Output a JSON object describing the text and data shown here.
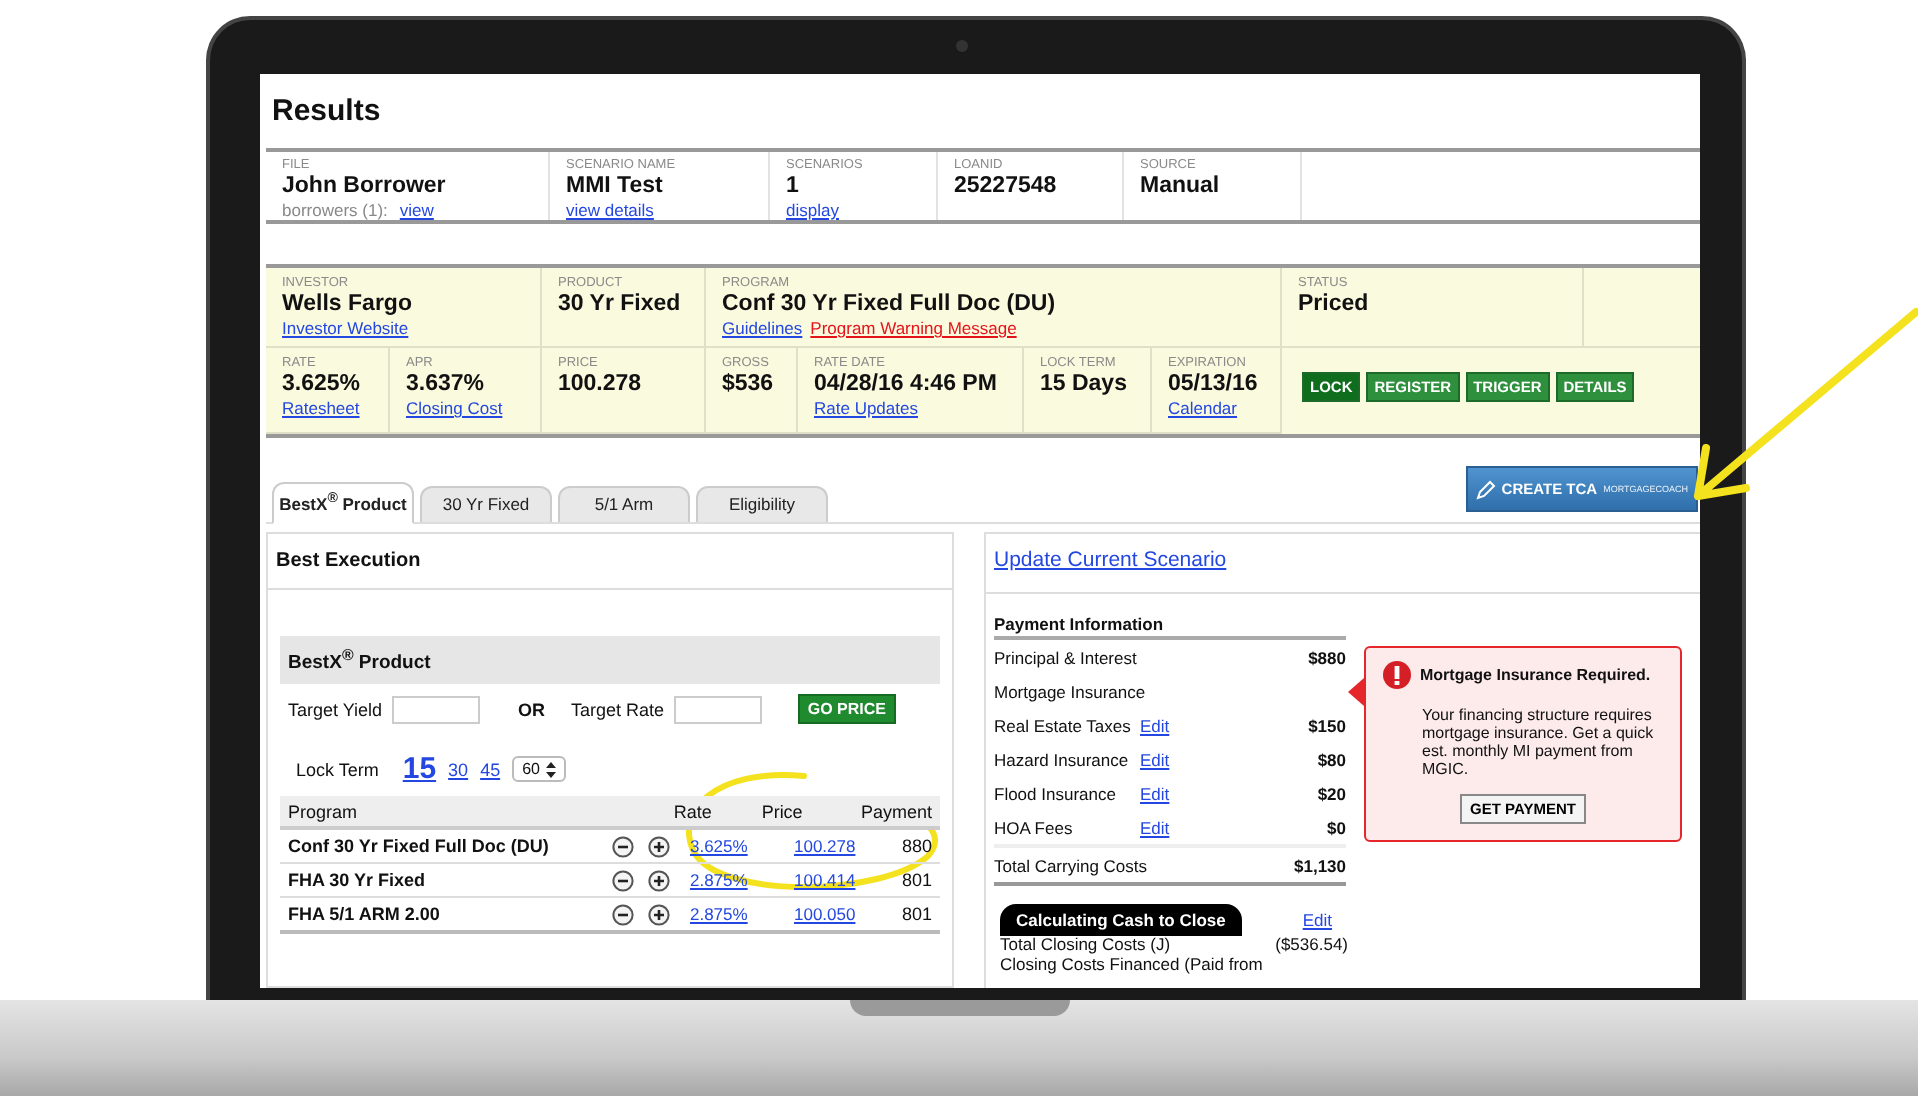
{
  "page_title": "Results",
  "file_summary": [
    {
      "label": "FILE",
      "value": "John Borrower",
      "note": "borrowers (1):",
      "link": "view"
    },
    {
      "label": "SCENARIO NAME",
      "value": "MMI Test",
      "link": "view details"
    },
    {
      "label": "SCENARIOS",
      "value": "1",
      "link": "display"
    },
    {
      "label": "LOANID",
      "value": "25227548"
    },
    {
      "label": "SOURCE",
      "value": "Manual"
    }
  ],
  "loan_summary": {
    "cells": [
      {
        "label": "INVESTOR",
        "value": "Wells Fargo",
        "links": [
          {
            "text": "Investor Website",
            "kind": "link"
          }
        ]
      },
      {
        "label": "PRODUCT",
        "value": "30 Yr Fixed"
      },
      {
        "label": "PROGRAM",
        "value": "Conf 30 Yr Fixed Full Doc (DU)",
        "links": [
          {
            "text": "Guidelines",
            "kind": "link"
          },
          {
            "text": "Program Warning Message",
            "kind": "warning"
          }
        ]
      },
      {
        "label": "STATUS",
        "value": "Priced"
      },
      {
        "label": "RATE",
        "value": "3.625%",
        "links": [
          {
            "text": "Ratesheet",
            "kind": "link"
          }
        ]
      },
      {
        "label": "APR",
        "value": "3.637%",
        "links": [
          {
            "text": "Closing Cost",
            "kind": "link"
          }
        ]
      },
      {
        "label": "PRICE",
        "value": "100.278"
      },
      {
        "label": "GROSS",
        "value": "$536"
      },
      {
        "label": "RATE DATE",
        "value": "04/28/16 4:46 PM",
        "links": [
          {
            "text": "Rate Updates",
            "kind": "link"
          }
        ]
      },
      {
        "label": "LOCK TERM",
        "value": "15 Days"
      },
      {
        "label": "EXPIRATION",
        "value": "05/13/16",
        "links": [
          {
            "text": "Calendar",
            "kind": "link"
          }
        ]
      }
    ],
    "actions": [
      "LOCK",
      "REGISTER",
      "TRIGGER",
      "DETAILS"
    ]
  },
  "tabs": [
    {
      "label": "BestX$^{®}$ Product",
      "selected": true
    },
    {
      "label": "30 Yr Fixed",
      "selected": false
    },
    {
      "label": "5/1 Arm",
      "selected": false
    },
    {
      "label": "Eligibility",
      "selected": false
    }
  ],
  "create_tca": {
    "label": "CREATE TCA",
    "brand": "MORTGAGECOACH"
  },
  "best_execution": {
    "title": "Best Execution",
    "product_title": "BestX$^{®}$ Product",
    "target_yield_label": "Target Yield",
    "or_label": "OR",
    "target_rate_label": "Target Rate",
    "go_button": "GO PRICE",
    "lock_term_label": "Lock Term",
    "lock_terms": [
      {
        "label": "15",
        "selected": true
      },
      {
        "label": "30",
        "selected": false
      },
      {
        "label": "45",
        "selected": false
      }
    ],
    "lock_select": "60",
    "columns": [
      "Program",
      "Rate",
      "Price",
      "Payment"
    ],
    "rows": [
      {
        "program": "Conf 30 Yr Fixed Full Doc (DU)",
        "rate": "3.625%",
        "price": "100.278",
        "payment": "880"
      },
      {
        "program": "FHA 30 Yr Fixed",
        "rate": "2.875%",
        "price": "100.414",
        "payment": "801"
      },
      {
        "program": "FHA 5/1 ARM 2.00",
        "rate": "2.875%",
        "price": "100.050",
        "payment": "801"
      }
    ]
  },
  "payment": {
    "update_link": "Update Current Scenario",
    "title": "Payment Information",
    "items": [
      {
        "label": "Principal & Interest",
        "value": "$880"
      },
      {
        "label": "Mortgage Insurance"
      },
      {
        "label": "Real Estate Taxes",
        "edit": "Edit",
        "value": "$150"
      },
      {
        "label": "Hazard Insurance",
        "edit": "Edit",
        "value": "$80"
      },
      {
        "label": "Flood Insurance",
        "edit": "Edit",
        "value": "$20"
      },
      {
        "label": "HOA Fees",
        "edit": "Edit",
        "value": "$0"
      }
    ],
    "total": {
      "label": "Total Carrying Costs",
      "value": "$1,130"
    },
    "cash_title": "Calculating Cash to Close",
    "cash_edit": "Edit",
    "cash_rows": [
      {
        "label": "Total Closing Costs (J)",
        "value": "($536.54)"
      },
      {
        "label": "Closing Costs Financed (Paid from"
      }
    ]
  },
  "alert": {
    "title": "Mortgage Insurance Required.",
    "body": "Your financing structure requires mortgage insurance. Get a quick est. monthly MI payment from MGIC.",
    "button": "GET PAYMENT"
  }
}
